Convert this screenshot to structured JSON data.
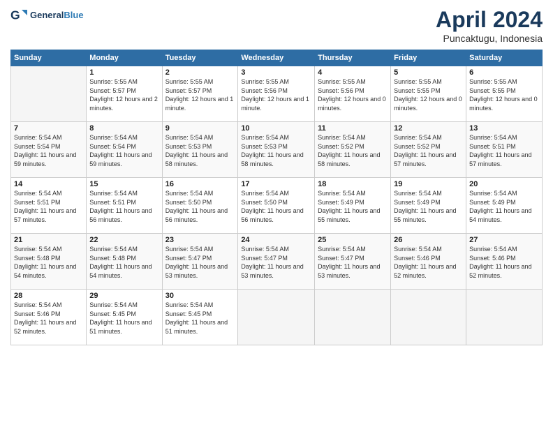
{
  "header": {
    "logo_general": "General",
    "logo_blue": "Blue",
    "title": "April 2024",
    "subtitle": "Puncaktugu, Indonesia"
  },
  "columns": [
    "Sunday",
    "Monday",
    "Tuesday",
    "Wednesday",
    "Thursday",
    "Friday",
    "Saturday"
  ],
  "weeks": [
    [
      {
        "day": "",
        "sunrise": "",
        "sunset": "",
        "daylight": ""
      },
      {
        "day": "1",
        "sunrise": "Sunrise: 5:55 AM",
        "sunset": "Sunset: 5:57 PM",
        "daylight": "Daylight: 12 hours and 2 minutes."
      },
      {
        "day": "2",
        "sunrise": "Sunrise: 5:55 AM",
        "sunset": "Sunset: 5:57 PM",
        "daylight": "Daylight: 12 hours and 1 minute."
      },
      {
        "day": "3",
        "sunrise": "Sunrise: 5:55 AM",
        "sunset": "Sunset: 5:56 PM",
        "daylight": "Daylight: 12 hours and 1 minute."
      },
      {
        "day": "4",
        "sunrise": "Sunrise: 5:55 AM",
        "sunset": "Sunset: 5:56 PM",
        "daylight": "Daylight: 12 hours and 0 minutes."
      },
      {
        "day": "5",
        "sunrise": "Sunrise: 5:55 AM",
        "sunset": "Sunset: 5:55 PM",
        "daylight": "Daylight: 12 hours and 0 minutes."
      },
      {
        "day": "6",
        "sunrise": "Sunrise: 5:55 AM",
        "sunset": "Sunset: 5:55 PM",
        "daylight": "Daylight: 12 hours and 0 minutes."
      }
    ],
    [
      {
        "day": "7",
        "sunrise": "Sunrise: 5:54 AM",
        "sunset": "Sunset: 5:54 PM",
        "daylight": "Daylight: 11 hours and 59 minutes."
      },
      {
        "day": "8",
        "sunrise": "Sunrise: 5:54 AM",
        "sunset": "Sunset: 5:54 PM",
        "daylight": "Daylight: 11 hours and 59 minutes."
      },
      {
        "day": "9",
        "sunrise": "Sunrise: 5:54 AM",
        "sunset": "Sunset: 5:53 PM",
        "daylight": "Daylight: 11 hours and 58 minutes."
      },
      {
        "day": "10",
        "sunrise": "Sunrise: 5:54 AM",
        "sunset": "Sunset: 5:53 PM",
        "daylight": "Daylight: 11 hours and 58 minutes."
      },
      {
        "day": "11",
        "sunrise": "Sunrise: 5:54 AM",
        "sunset": "Sunset: 5:52 PM",
        "daylight": "Daylight: 11 hours and 58 minutes."
      },
      {
        "day": "12",
        "sunrise": "Sunrise: 5:54 AM",
        "sunset": "Sunset: 5:52 PM",
        "daylight": "Daylight: 11 hours and 57 minutes."
      },
      {
        "day": "13",
        "sunrise": "Sunrise: 5:54 AM",
        "sunset": "Sunset: 5:51 PM",
        "daylight": "Daylight: 11 hours and 57 minutes."
      }
    ],
    [
      {
        "day": "14",
        "sunrise": "Sunrise: 5:54 AM",
        "sunset": "Sunset: 5:51 PM",
        "daylight": "Daylight: 11 hours and 57 minutes."
      },
      {
        "day": "15",
        "sunrise": "Sunrise: 5:54 AM",
        "sunset": "Sunset: 5:51 PM",
        "daylight": "Daylight: 11 hours and 56 minutes."
      },
      {
        "day": "16",
        "sunrise": "Sunrise: 5:54 AM",
        "sunset": "Sunset: 5:50 PM",
        "daylight": "Daylight: 11 hours and 56 minutes."
      },
      {
        "day": "17",
        "sunrise": "Sunrise: 5:54 AM",
        "sunset": "Sunset: 5:50 PM",
        "daylight": "Daylight: 11 hours and 56 minutes."
      },
      {
        "day": "18",
        "sunrise": "Sunrise: 5:54 AM",
        "sunset": "Sunset: 5:49 PM",
        "daylight": "Daylight: 11 hours and 55 minutes."
      },
      {
        "day": "19",
        "sunrise": "Sunrise: 5:54 AM",
        "sunset": "Sunset: 5:49 PM",
        "daylight": "Daylight: 11 hours and 55 minutes."
      },
      {
        "day": "20",
        "sunrise": "Sunrise: 5:54 AM",
        "sunset": "Sunset: 5:49 PM",
        "daylight": "Daylight: 11 hours and 54 minutes."
      }
    ],
    [
      {
        "day": "21",
        "sunrise": "Sunrise: 5:54 AM",
        "sunset": "Sunset: 5:48 PM",
        "daylight": "Daylight: 11 hours and 54 minutes."
      },
      {
        "day": "22",
        "sunrise": "Sunrise: 5:54 AM",
        "sunset": "Sunset: 5:48 PM",
        "daylight": "Daylight: 11 hours and 54 minutes."
      },
      {
        "day": "23",
        "sunrise": "Sunrise: 5:54 AM",
        "sunset": "Sunset: 5:47 PM",
        "daylight": "Daylight: 11 hours and 53 minutes."
      },
      {
        "day": "24",
        "sunrise": "Sunrise: 5:54 AM",
        "sunset": "Sunset: 5:47 PM",
        "daylight": "Daylight: 11 hours and 53 minutes."
      },
      {
        "day": "25",
        "sunrise": "Sunrise: 5:54 AM",
        "sunset": "Sunset: 5:47 PM",
        "daylight": "Daylight: 11 hours and 53 minutes."
      },
      {
        "day": "26",
        "sunrise": "Sunrise: 5:54 AM",
        "sunset": "Sunset: 5:46 PM",
        "daylight": "Daylight: 11 hours and 52 minutes."
      },
      {
        "day": "27",
        "sunrise": "Sunrise: 5:54 AM",
        "sunset": "Sunset: 5:46 PM",
        "daylight": "Daylight: 11 hours and 52 minutes."
      }
    ],
    [
      {
        "day": "28",
        "sunrise": "Sunrise: 5:54 AM",
        "sunset": "Sunset: 5:46 PM",
        "daylight": "Daylight: 11 hours and 52 minutes."
      },
      {
        "day": "29",
        "sunrise": "Sunrise: 5:54 AM",
        "sunset": "Sunset: 5:45 PM",
        "daylight": "Daylight: 11 hours and 51 minutes."
      },
      {
        "day": "30",
        "sunrise": "Sunrise: 5:54 AM",
        "sunset": "Sunset: 5:45 PM",
        "daylight": "Daylight: 11 hours and 51 minutes."
      },
      {
        "day": "",
        "sunrise": "",
        "sunset": "",
        "daylight": ""
      },
      {
        "day": "",
        "sunrise": "",
        "sunset": "",
        "daylight": ""
      },
      {
        "day": "",
        "sunrise": "",
        "sunset": "",
        "daylight": ""
      },
      {
        "day": "",
        "sunrise": "",
        "sunset": "",
        "daylight": ""
      }
    ]
  ]
}
